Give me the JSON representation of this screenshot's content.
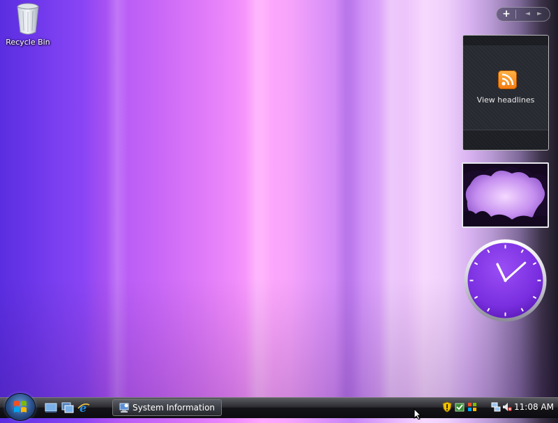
{
  "desktop": {
    "recycle_bin_label": "Recycle Bin",
    "background_colors": {
      "left": "#5a2ee0",
      "center": "#ffa8fc",
      "right": "#1e1a26"
    }
  },
  "sidebar": {
    "controls": {
      "add_label": "+",
      "prev_label": "◄",
      "next_label": "►"
    },
    "feed_gadget": {
      "label": "View headlines",
      "icon": "rss-feed-icon",
      "accent": "#f47a0e"
    },
    "slideshow_gadget": {
      "icon": "slideshow-image"
    },
    "clock_gadget": {
      "hour": 11,
      "minute": 8,
      "face_color": "#7a2fe0"
    }
  },
  "taskbar": {
    "start_icon": "windows-start-orb",
    "quick_launch": [
      {
        "name": "show-desktop-icon"
      },
      {
        "name": "switch-windows-icon"
      },
      {
        "name": "internet-explorer-icon"
      }
    ],
    "tasks": [
      {
        "label": "System Information",
        "icon": "system-information-icon"
      }
    ],
    "tray": {
      "icons": [
        "security-alert-icon",
        "defender-icon",
        "windows-update-icon",
        "network-icon",
        "volume-muted-icon"
      ],
      "time": "11:08 AM"
    }
  }
}
